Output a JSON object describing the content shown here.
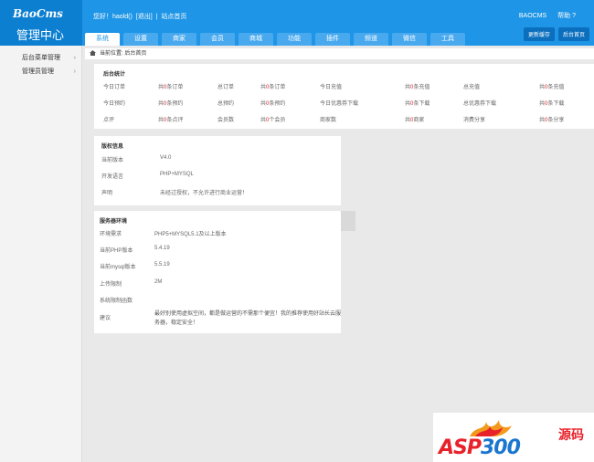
{
  "header": {
    "logo": "BaoCms",
    "subtitle": "管理中心",
    "welcome": [
      "您好！haold()",
      "[退出]",
      "站点首页"
    ],
    "brand": "BAOCMS",
    "help": "帮助 ?",
    "buttons": [
      "更新缓存",
      "后台首页"
    ]
  },
  "tabs": [
    "系统",
    "设置",
    "商家",
    "会员",
    "商城",
    "功能",
    "插件",
    "频道",
    "微信",
    "工具"
  ],
  "sidebar": {
    "items": [
      {
        "label": "后台菜单管理",
        "chevron": "›"
      },
      {
        "label": "管理员管理",
        "chevron": "›"
      }
    ]
  },
  "breadcrumb": "当前位置: 后台首页",
  "stats": {
    "title": "后台统计",
    "rows": [
      [
        {
          "label": "今日订单",
          "value": ""
        },
        {
          "prefix": "共",
          "num": "0",
          "suffix": "条订单"
        },
        {
          "label": "总订单"
        },
        {
          "prefix": "共",
          "num": "0",
          "suffix": "条订单"
        },
        {
          "label": "今日充值"
        },
        {
          "prefix": "共",
          "num": "0",
          "suffix": "条充值"
        },
        {
          "label": "总充值"
        },
        {
          "prefix": "共",
          "num": "0",
          "suffix": "条充值"
        }
      ],
      [
        {
          "label": "今日预约"
        },
        {
          "prefix": "共",
          "num": "0",
          "suffix": "条预约"
        },
        {
          "label": "总预约"
        },
        {
          "prefix": "共",
          "num": "0",
          "suffix": "条预约"
        },
        {
          "label": "今日优惠券下载"
        },
        {
          "prefix": "共",
          "num": "0",
          "suffix": "条下载"
        },
        {
          "label": "总优惠券下载"
        },
        {
          "prefix": "共",
          "num": "0",
          "suffix": "条下载"
        }
      ],
      [
        {
          "label": "点评"
        },
        {
          "prefix": "共",
          "num": "0",
          "suffix": "条点评"
        },
        {
          "label": "会员数"
        },
        {
          "prefix": "共",
          "num": "0",
          "suffix": "个会员"
        },
        {
          "label": "商家数"
        },
        {
          "prefix": "共",
          "num": "0",
          "suffix": "商家"
        },
        {
          "label": "消费分享"
        },
        {
          "prefix": "共",
          "num": "0",
          "suffix": "条分享"
        }
      ]
    ]
  },
  "version": {
    "title": "版权信息",
    "rows": [
      {
        "k": "当前版本",
        "v": "V4.0"
      },
      {
        "k": "开发语言",
        "v": "PHP+MYSQL"
      },
      {
        "k": "声明",
        "v": "未经过授权，不允许进行商业运营！"
      }
    ]
  },
  "server": {
    "title": "服务器环境",
    "rows": [
      {
        "k": "环境需求",
        "v": "PHP5+MYSQL5.1及以上版本"
      },
      {
        "k": "当前PHP版本",
        "v": "5.4.19"
      },
      {
        "k": "当前mysql版本",
        "v": "5.5.19"
      },
      {
        "k": "上传限制",
        "v": "2M"
      },
      {
        "k": "系统限制函数",
        "v": ""
      }
    ],
    "advice_label": "建议",
    "advice": "最好别使用虚拟空间，都是做运营的不需那个便宜！我的推荐使用好站长云服务器，稳定安全！"
  },
  "watermark": {
    "text_red": "ASP",
    "text_blue": "300",
    "cn": "源码"
  },
  "colors": {
    "header": "#1e95e6",
    "logo_bg": "#0d7fd1",
    "tab": "#48a9ef",
    "red_num": "#dd2222"
  }
}
